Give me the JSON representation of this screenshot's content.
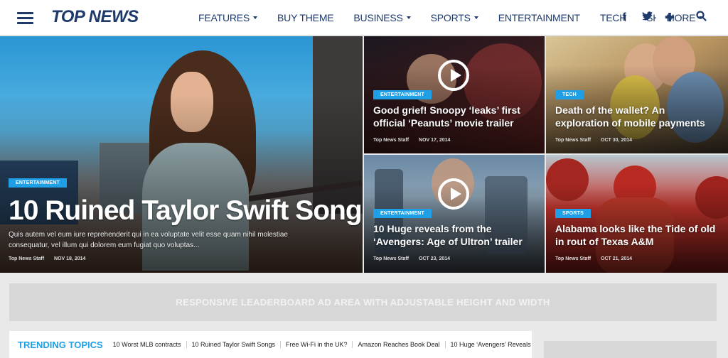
{
  "brand": {
    "logo": "TOP NEWS",
    "color": "#1d3a6b",
    "accent": "#1e9fe6"
  },
  "nav": {
    "items": [
      {
        "label": "FEATURES",
        "dropdown": true
      },
      {
        "label": "BUY THEME",
        "dropdown": false
      },
      {
        "label": "BUSINESS",
        "dropdown": true
      },
      {
        "label": "SPORTS",
        "dropdown": true
      },
      {
        "label": "ENTERTAINMENT",
        "dropdown": false
      },
      {
        "label": "TECH",
        "dropdown": false
      },
      {
        "label": "SH",
        "dropdown": false
      },
      {
        "label": "MORE",
        "dropdown": true
      }
    ],
    "icons": [
      "facebook-icon",
      "twitter-icon",
      "plus-icon",
      "search-icon"
    ]
  },
  "hero": {
    "category": "ENTERTAINMENT",
    "title": "10 Ruined Taylor Swift Songs",
    "excerpt": "Quis autem vel eum iure reprehenderit qui in ea voluptate velit esse quam nihil molestiae consequatur, vel illum qui dolorem eum fugiat quo voluptas...",
    "author": "Top News Staff",
    "date": "NOV 18, 2014"
  },
  "tiles": [
    {
      "category": "ENTERTAINMENT",
      "title": "Good grief! Snoopy ‘leaks’ first official ‘Peanuts’ movie trailer",
      "author": "Top News Staff",
      "date": "NOV 17, 2014",
      "video": true
    },
    {
      "category": "TECH",
      "title": "Death of the wallet? An exploration of mobile payments",
      "author": "Top News Staff",
      "date": "OCT 30, 2014",
      "video": false
    },
    {
      "category": "ENTERTAINMENT",
      "title": "10 Huge reveals from the ‘Avengers: Age of Ultron’ trailer",
      "author": "Top News Staff",
      "date": "OCT 23, 2014",
      "video": true
    },
    {
      "category": "SPORTS",
      "title": "Alabama looks like the Tide of old in rout of Texas A&M",
      "author": "Top News Staff",
      "date": "OCT 21, 2014",
      "video": false
    }
  ],
  "ad": {
    "text": "RESPONSIVE LEADERBOARD AD AREA WITH ADJUSTABLE HEIGHT AND WIDTH"
  },
  "trending": {
    "label": "TRENDING TOPICS",
    "links": [
      "10 Worst MLB contracts",
      "10 Ruined Taylor Swift Songs",
      "Free Wi-Fi in the UK?",
      "Amazon Reaches Book Deal",
      "10 Huge ‘Avengers’ Reveals"
    ]
  }
}
